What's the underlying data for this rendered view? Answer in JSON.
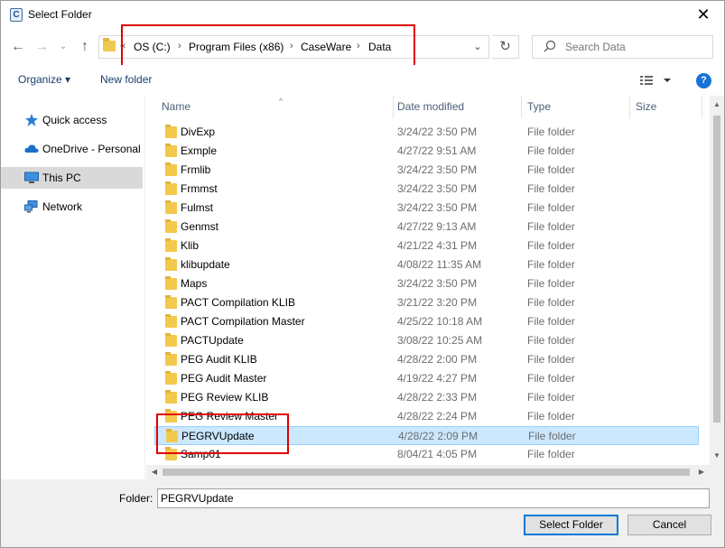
{
  "window": {
    "title": "Select Folder",
    "app_icon": "C"
  },
  "nav": {
    "breadcrumb": [
      "OS (C:)",
      "Program Files (x86)",
      "CaseWare",
      "Data"
    ],
    "overflow_glyph": "«",
    "separator": "›",
    "search_placeholder": "Search Data"
  },
  "toolbar": {
    "organize_label": "Organize ▾",
    "new_folder_label": "New folder",
    "help_label": "?"
  },
  "sidebar": {
    "items": [
      {
        "label": "Quick access",
        "icon": "star-icon"
      },
      {
        "label": "OneDrive - Personal",
        "icon": "cloud-icon"
      },
      {
        "label": "This PC",
        "icon": "computer-icon"
      },
      {
        "label": "Network",
        "icon": "network-icon"
      }
    ]
  },
  "columns": {
    "name": "Name",
    "date": "Date modified",
    "type": "Type",
    "size": "Size"
  },
  "files": [
    {
      "name": "DivExp",
      "date": "3/24/22 3:50 PM",
      "type": "File folder"
    },
    {
      "name": "Exmple",
      "date": "4/27/22 9:51 AM",
      "type": "File folder"
    },
    {
      "name": "Frmlib",
      "date": "3/24/22 3:50 PM",
      "type": "File folder"
    },
    {
      "name": "Frmmst",
      "date": "3/24/22 3:50 PM",
      "type": "File folder"
    },
    {
      "name": "Fulmst",
      "date": "3/24/22 3:50 PM",
      "type": "File folder"
    },
    {
      "name": "Genmst",
      "date": "4/27/22 9:13 AM",
      "type": "File folder"
    },
    {
      "name": "Klib",
      "date": "4/21/22 4:31 PM",
      "type": "File folder"
    },
    {
      "name": "klibupdate",
      "date": "4/08/22 11:35 AM",
      "type": "File folder"
    },
    {
      "name": "Maps",
      "date": "3/24/22 3:50 PM",
      "type": "File folder"
    },
    {
      "name": "PACT Compilation KLIB",
      "date": "3/21/22 3:20 PM",
      "type": "File folder"
    },
    {
      "name": "PACT Compilation Master",
      "date": "4/25/22 10:18 AM",
      "type": "File folder"
    },
    {
      "name": "PACTUpdate",
      "date": "3/08/22 10:25 AM",
      "type": "File folder"
    },
    {
      "name": "PEG Audit KLIB",
      "date": "4/28/22 2:00 PM",
      "type": "File folder"
    },
    {
      "name": "PEG Audit Master",
      "date": "4/19/22 4:27 PM",
      "type": "File folder"
    },
    {
      "name": "PEG Review KLIB",
      "date": "4/28/22 2:33 PM",
      "type": "File folder"
    },
    {
      "name": "PEG Review Master",
      "date": "4/28/22 2:24 PM",
      "type": "File folder"
    },
    {
      "name": "PEGRVUpdate",
      "date": "4/28/22 2:09 PM",
      "type": "File folder"
    },
    {
      "name": "Samp01",
      "date": "8/04/21 4:05 PM",
      "type": "File folder"
    }
  ],
  "selected_index": 16,
  "bottom": {
    "folder_label": "Folder:",
    "folder_value": "PEGRVUpdate",
    "select_label": "Select Folder",
    "cancel_label": "Cancel"
  },
  "colors": {
    "accent": "#0078d7",
    "selection": "#cce8ff",
    "annotation": "#e00000",
    "folder": "#f3c94d"
  }
}
